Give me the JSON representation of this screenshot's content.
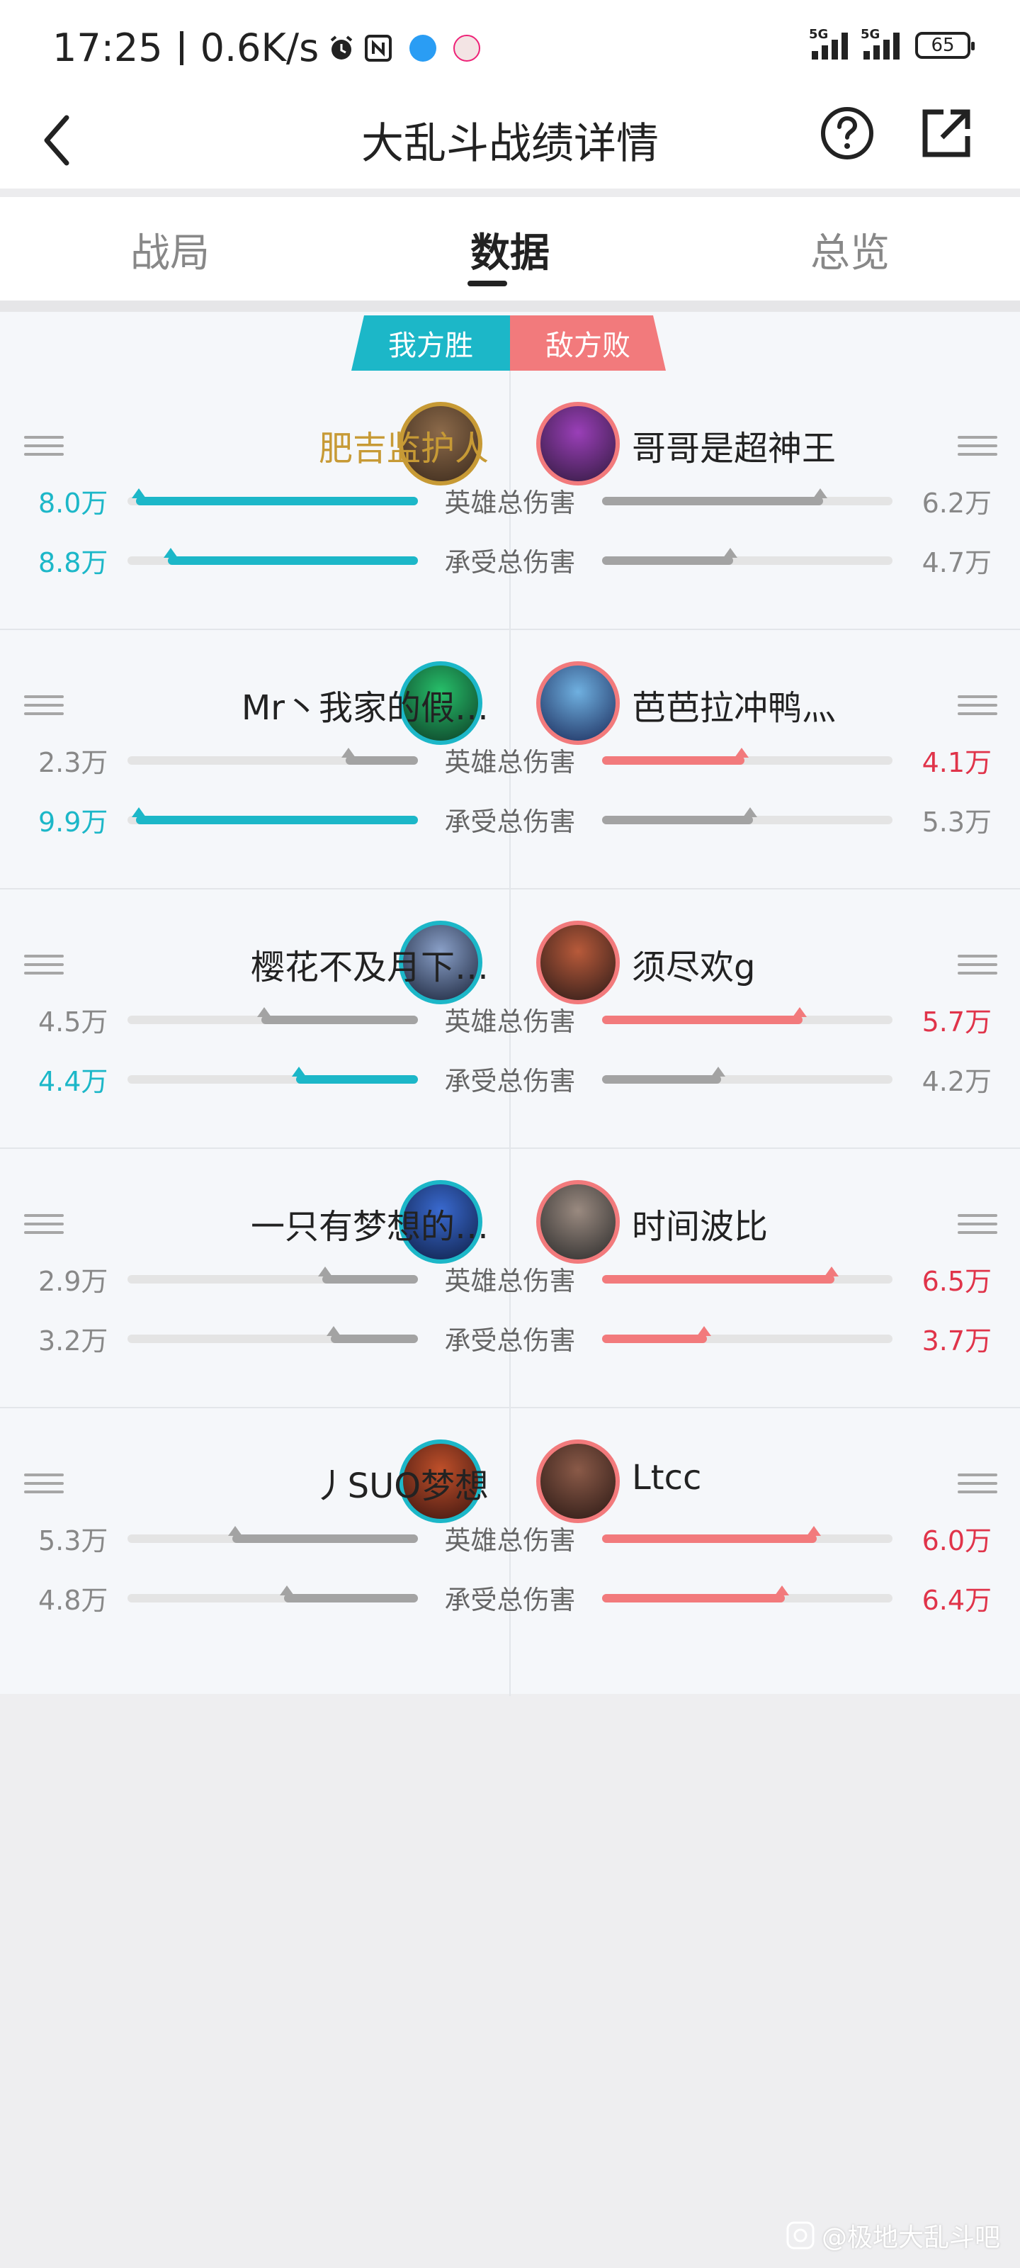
{
  "status_bar": {
    "time": "17:25",
    "speed": "0.6K/s",
    "signal1": "5G",
    "signal2": "5G",
    "battery": "65"
  },
  "header": {
    "title": "大乱斗战绩详情"
  },
  "tabs": [
    {
      "label": "战局",
      "active": false
    },
    {
      "label": "数据",
      "active": true
    },
    {
      "label": "总览",
      "active": false
    }
  ],
  "teams": {
    "left": "我方胜",
    "right": "敌方败"
  },
  "stat_labels": {
    "dmg": "英雄总伤害",
    "taken": "承受总伤害"
  },
  "colors": {
    "win": "#1cb7c8",
    "lose": "#f27a7c",
    "gray": "#a3a3a3",
    "gold": "#c79a35"
  },
  "rows": [
    {
      "left": {
        "name": "肥吉监护人",
        "dmg": "8.0万",
        "dmg_frac": 0.97,
        "dmg_hl": true,
        "taken": "8.8万",
        "taken_frac": 0.86,
        "taken_hl": true
      },
      "right": {
        "name": "哥哥是超神王",
        "dmg": "6.2万",
        "dmg_frac": 0.76,
        "dmg_hl": false,
        "taken": "4.7万",
        "taken_frac": 0.45,
        "taken_hl": false
      }
    },
    {
      "left": {
        "name": "Mr丶我家的假…",
        "dmg": "2.3万",
        "dmg_frac": 0.25,
        "dmg_hl": false,
        "taken": "9.9万",
        "taken_frac": 0.97,
        "taken_hl": true
      },
      "right": {
        "name": "芭芭拉冲鸭灬",
        "dmg": "4.1万",
        "dmg_frac": 0.49,
        "dmg_hl": true,
        "taken": "5.3万",
        "taken_frac": 0.52,
        "taken_hl": false
      }
    },
    {
      "left": {
        "name": "樱花不及月下…",
        "dmg": "4.5万",
        "dmg_frac": 0.54,
        "dmg_hl": false,
        "taken": "4.4万",
        "taken_frac": 0.42,
        "taken_hl": true
      },
      "right": {
        "name": "须尽欢g",
        "dmg": "5.7万",
        "dmg_frac": 0.69,
        "dmg_hl": true,
        "taken": "4.2万",
        "taken_frac": 0.41,
        "taken_hl": false
      }
    },
    {
      "left": {
        "name": "一只有梦想的…",
        "dmg": "2.9万",
        "dmg_frac": 0.33,
        "dmg_hl": false,
        "taken": "3.2万",
        "taken_frac": 0.3,
        "taken_hl": false
      },
      "right": {
        "name": "时间波比",
        "dmg": "6.5万",
        "dmg_frac": 0.8,
        "dmg_hl": true,
        "taken": "3.7万",
        "taken_frac": 0.36,
        "taken_hl": true
      }
    },
    {
      "left": {
        "name": "丿SUO梦想",
        "dmg": "5.3万",
        "dmg_frac": 0.64,
        "dmg_hl": false,
        "taken": "4.8万",
        "taken_frac": 0.46,
        "taken_hl": false
      },
      "right": {
        "name": "Ltcc",
        "dmg": "6.0万",
        "dmg_frac": 0.74,
        "dmg_hl": true,
        "taken": "6.4万",
        "taken_frac": 0.63,
        "taken_hl": true
      }
    }
  ],
  "watermark": "@极地大乱斗吧"
}
